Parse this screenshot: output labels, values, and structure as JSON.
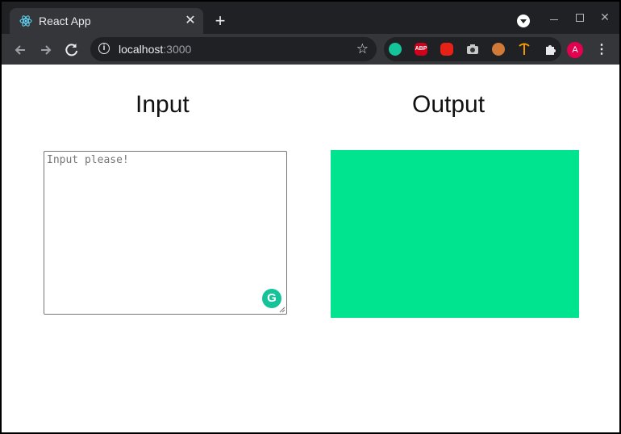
{
  "browser": {
    "tab": {
      "title": "React App",
      "favicon": "react-icon",
      "close_glyph": "✕"
    },
    "new_tab_glyph": "+",
    "address": {
      "host": "localhost",
      "port": ":3000"
    },
    "extensions": {
      "grammarly": "",
      "abp": "ABP",
      "youtube": "",
      "camera": "",
      "cookie": "",
      "pick": "",
      "puzzle": ""
    },
    "profile_initial": "A"
  },
  "page": {
    "input_heading": "Input",
    "output_heading": "Output",
    "input_placeholder": "Input please!",
    "output_color": "#00e38f"
  },
  "colors": {
    "accent_grammarly": "#15c39a",
    "profile_avatar": "#e3004f"
  }
}
